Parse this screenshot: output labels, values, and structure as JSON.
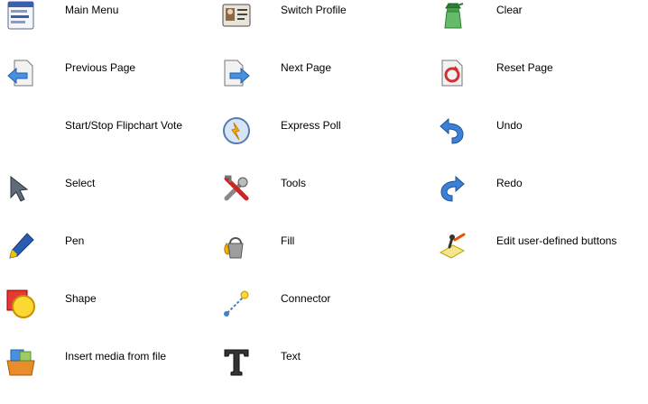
{
  "legend": {
    "items": [
      {
        "label": "Main Menu",
        "icon": "main-menu-icon"
      },
      {
        "label": "Switch Profile",
        "icon": "switch-profile-icon"
      },
      {
        "label": "Clear",
        "icon": "clear-spray-bottle-icon"
      },
      {
        "label": "Previous Page",
        "icon": "previous-page-icon"
      },
      {
        "label": "Next Page",
        "icon": "next-page-icon"
      },
      {
        "label": "Reset Page",
        "icon": "reset-page-icon"
      },
      {
        "label": "Start/Stop Flipchart Vote",
        "icon": ""
      },
      {
        "label": "Express Poll",
        "icon": "express-poll-icon"
      },
      {
        "label": "Undo",
        "icon": "undo-icon"
      },
      {
        "label": "Select",
        "icon": "select-arrow-icon"
      },
      {
        "label": "Tools",
        "icon": "tools-icon"
      },
      {
        "label": "Redo",
        "icon": "redo-icon"
      },
      {
        "label": "Pen",
        "icon": "pen-icon"
      },
      {
        "label": "Fill",
        "icon": "fill-bucket-icon"
      },
      {
        "label": "Edit user-defined buttons",
        "icon": "edit-buttons-icon"
      },
      {
        "label": "Shape",
        "icon": "shape-icon"
      },
      {
        "label": "Connector",
        "icon": "connector-icon"
      },
      {
        "label": "",
        "icon": ""
      },
      {
        "label": "Insert media from file",
        "icon": "insert-media-icon"
      },
      {
        "label": "Text",
        "icon": "text-icon"
      }
    ]
  }
}
